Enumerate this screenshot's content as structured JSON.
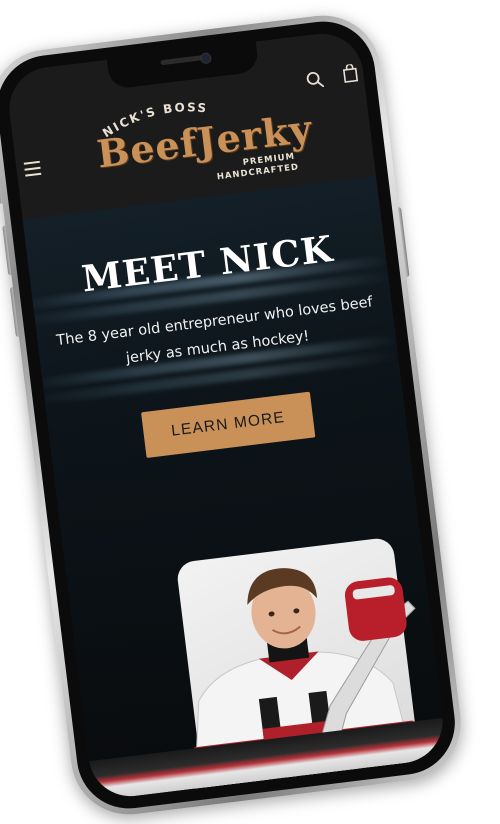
{
  "header": {
    "logo_arc_text": "NICK'S BOSS",
    "logo_main_text": "BeefJerky",
    "logo_sub_line1": "PREMIUM",
    "logo_sub_line2": "HANDCRAFTED",
    "menu_icon": "hamburger-icon",
    "search_icon": "search-icon",
    "cart_icon": "cart-icon"
  },
  "hero": {
    "title": "MEET NICK",
    "text": "The 8 year old entrepreneur who loves beef jerky as much as hockey!",
    "cta_label": "LEARN MORE"
  },
  "colors": {
    "accent": "#c99058",
    "header_bg": "#1b1b1b",
    "hero_bg": "#0e171d",
    "text_light": "#ffffff"
  }
}
